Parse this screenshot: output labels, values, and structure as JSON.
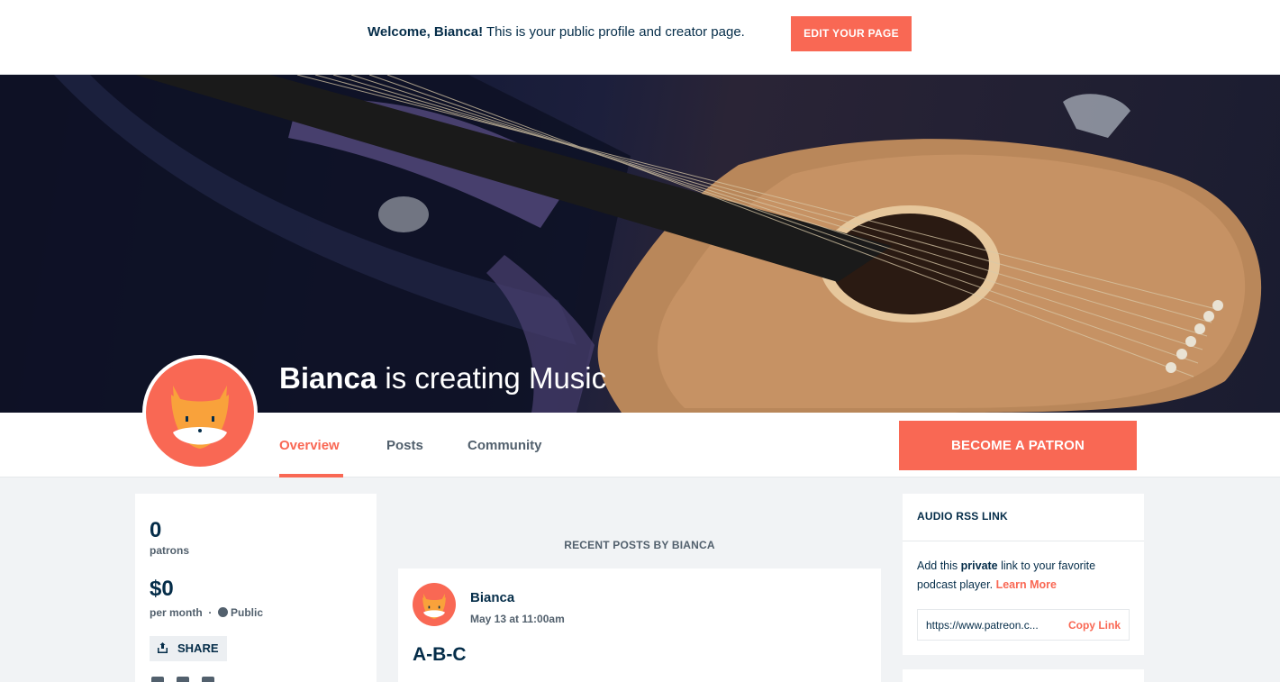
{
  "welcome": {
    "greeting": "Welcome, Bianca!",
    "message": " This is your public profile and creator page.",
    "edit_button": "EDIT YOUR PAGE"
  },
  "cover": {
    "creator_name": "Bianca",
    "tagline": " is creating Music"
  },
  "tabs": [
    {
      "label": "Overview",
      "active": true
    },
    {
      "label": "Posts",
      "active": false
    },
    {
      "label": "Community",
      "active": false
    }
  ],
  "become_patron_button": "BECOME A PATRON",
  "stats": {
    "patrons_count": "0",
    "patrons_label": "patrons",
    "earnings": "$0",
    "earnings_period": "per month",
    "separator": "·",
    "visibility": "Public",
    "share_label": "SHARE"
  },
  "feed": {
    "heading": "RECENT POSTS BY BIANCA",
    "post": {
      "author": "Bianca",
      "date": "May 13 at 11:00am",
      "title": "A-B-C"
    }
  },
  "rss": {
    "heading": "AUDIO RSS LINK",
    "desc_before": "Add this ",
    "desc_bold": "private",
    "desc_after": " link to your favorite podcast player. ",
    "learn_more": "Learn More",
    "url": "https://www.patreon.c...",
    "copy_link": "Copy Link"
  },
  "colors": {
    "brand": "#f96854",
    "navy": "#052d49",
    "muted": "#52606d",
    "page_bg": "#f1f3f5"
  },
  "icons": [
    "share-icon",
    "globe-icon",
    "facebook-icon",
    "twitter-icon",
    "youtube-icon",
    "fox-avatar"
  ]
}
